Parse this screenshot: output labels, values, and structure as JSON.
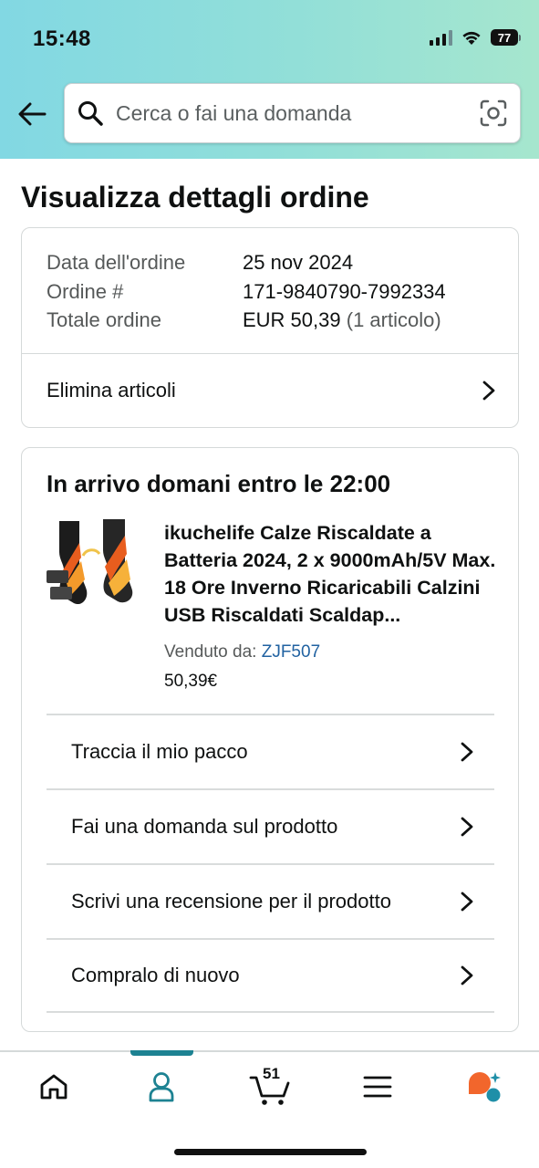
{
  "status_bar": {
    "time": "15:48",
    "battery": "77"
  },
  "search": {
    "placeholder": "Cerca o fai una domanda"
  },
  "page": {
    "title": "Visualizza dettagli ordine"
  },
  "order": {
    "rows": [
      {
        "label": "Data dell'ordine",
        "value": "25 nov 2024",
        "suffix": ""
      },
      {
        "label": "Ordine #",
        "value": "171-9840790-7992334",
        "suffix": ""
      },
      {
        "label": "Totale ordine",
        "value": "EUR 50,39",
        "suffix": " (1 articolo)"
      }
    ],
    "remove_items_label": "Elimina articoli"
  },
  "shipment": {
    "arrival_text": "In arrivo domani entro le 22:00",
    "product": {
      "title": "ikuchelife Calze Riscaldate a Batteria 2024, 2 x 9000mAh/5V Max. 18 Ore Inverno Ricaricabili Calzini USB Riscaldati Scaldap...",
      "seller_label": "Venduto da:",
      "seller_name": "ZJF507",
      "price": "50,39€"
    },
    "actions": [
      {
        "label": "Traccia il mio pacco"
      },
      {
        "label": "Fai una domanda sul prodotto"
      },
      {
        "label": "Scrivi una recensione per il prodotto"
      },
      {
        "label": "Compralo di nuovo"
      }
    ]
  },
  "bottom_nav": {
    "items": [
      "home-icon",
      "account-icon",
      "cart-icon",
      "menu-icon",
      "rufus-icon"
    ],
    "cart_count": "51",
    "active": "account-icon"
  },
  "colors": {
    "accent": "#1d8292",
    "link": "#2162a1",
    "header_start": "#82d8e3",
    "header_end": "#a6e6ce"
  }
}
